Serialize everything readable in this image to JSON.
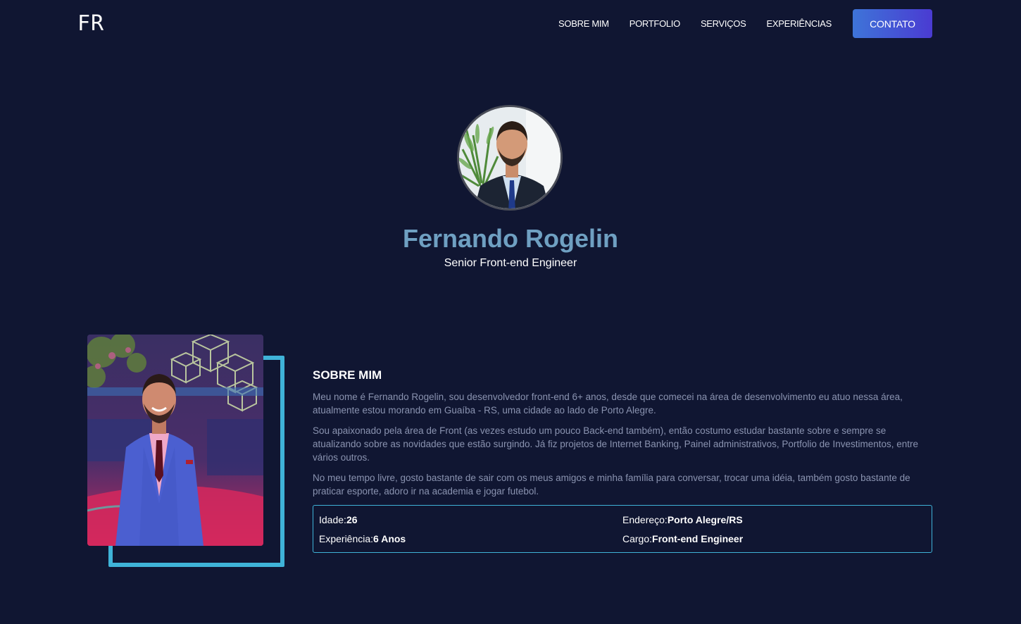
{
  "brand": {
    "logo": "FR"
  },
  "nav": {
    "links": [
      "SOBRE MIM",
      "PORTFOLIO",
      "SERVIÇOS",
      "EXPERIÊNCIAS"
    ],
    "cta": "CONTATO"
  },
  "hero": {
    "name": "Fernando Rogelin",
    "role": "Senior Front-end Engineer"
  },
  "about": {
    "title": "SOBRE MIM",
    "paragraphs": [
      "Meu nome é Fernando Rogelin, sou desenvolvedor front-end 6+ anos, desde que comecei na área de desenvolvimento eu atuo nessa área, atualmente estou morando em Guaíba - RS, uma cidade ao lado de Porto Alegre.",
      "Sou apaixonado pela área de Front (as vezes estudo um pouco Back-end também), então costumo estudar bastante sobre e sempre se atualizando sobre as novidades que estão surgindo. Já fiz projetos de Internet Banking, Painel administrativos, Portfolio de Investimentos, entre vários outros.",
      "No meu tempo livre, gosto bastante de sair com os meus amigos e minha família para conversar, trocar uma idéia, também gosto bastante de praticar esporte, adoro ir na academia e jogar futebol."
    ],
    "info": {
      "age_label": "Idade:",
      "age_value": "26",
      "address_label": "Endereço:",
      "address_value": "Porto Alegre/RS",
      "experience_label": "Experiência:",
      "experience_value": "6 Anos",
      "role_label": "Cargo:",
      "role_value": "Front-end Engineer"
    }
  },
  "colors": {
    "background": "#101632",
    "accent": "#3fb3d8",
    "name": "#6fa0c2",
    "cta_start": "#3e74d8",
    "cta_end": "#4a3bd2"
  }
}
